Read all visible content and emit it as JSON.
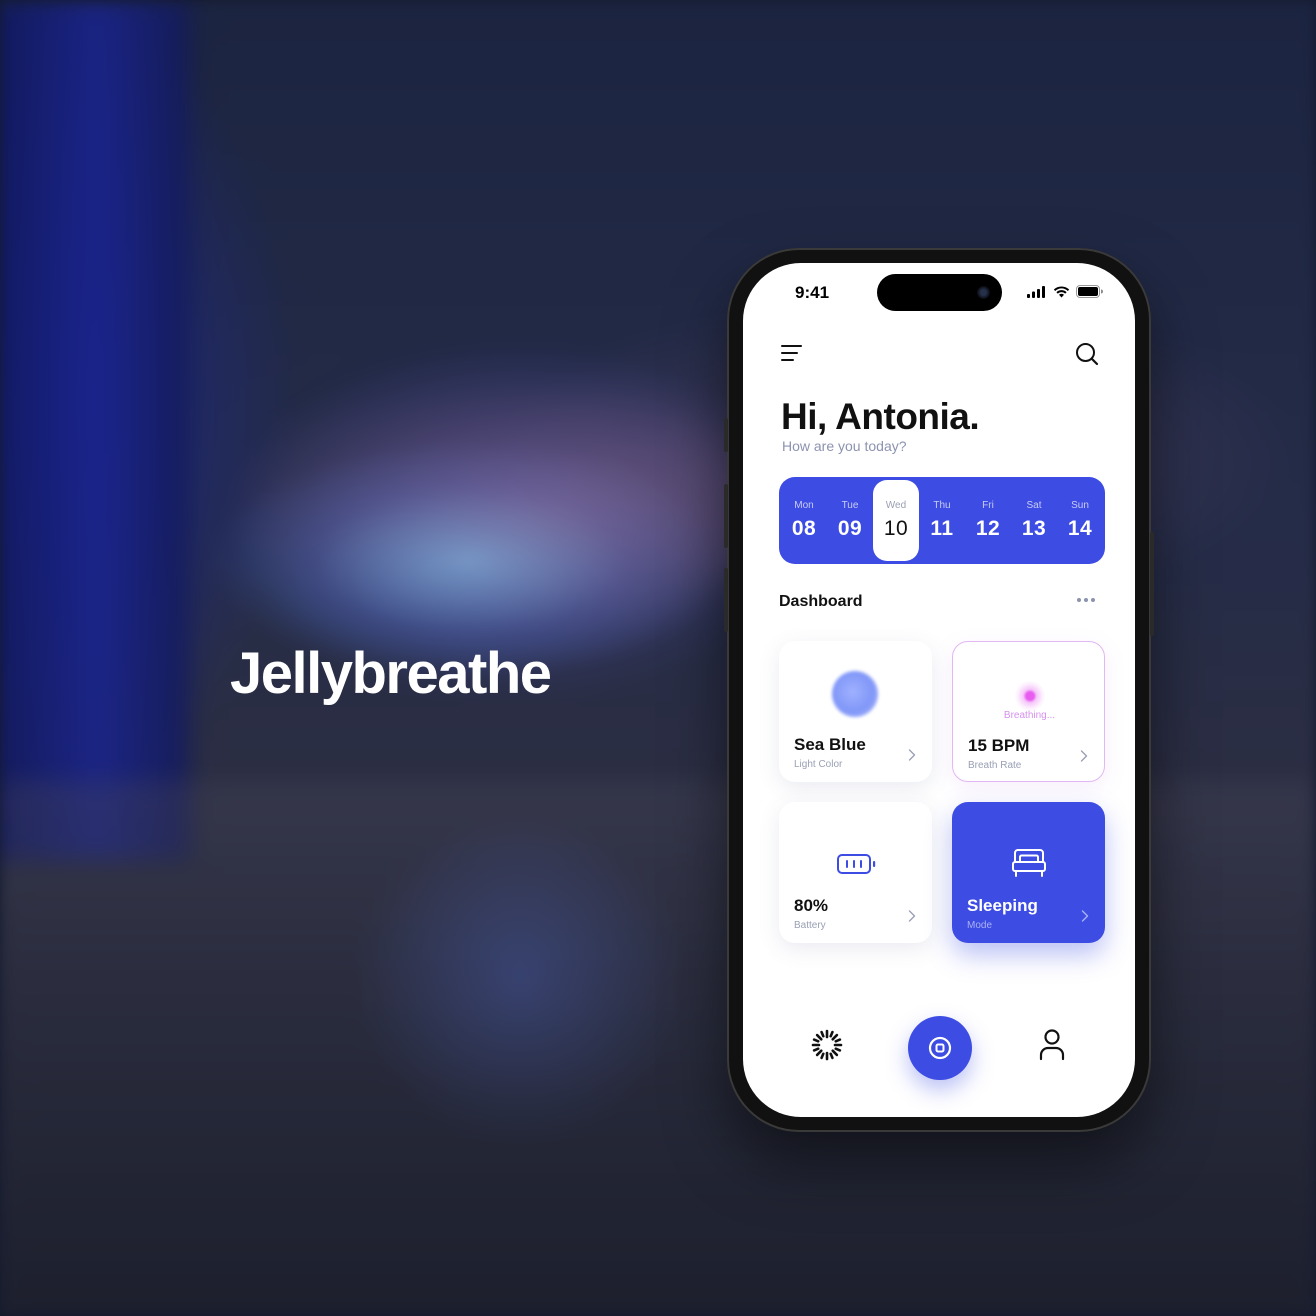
{
  "brand": {
    "name": "Jellybreathe"
  },
  "status_bar": {
    "time": "9:41"
  },
  "header": {
    "greeting": "Hi, Antonia.",
    "subtitle": "How are you today?"
  },
  "week": {
    "days": [
      {
        "name": "Mon",
        "num": "08"
      },
      {
        "name": "Tue",
        "num": "09"
      },
      {
        "name": "Wed",
        "num": "10"
      },
      {
        "name": "Thu",
        "num": "11"
      },
      {
        "name": "Fri",
        "num": "12"
      },
      {
        "name": "Sat",
        "num": "13"
      },
      {
        "name": "Sun",
        "num": "14"
      }
    ],
    "selected": "Wed"
  },
  "dashboard": {
    "title": "Dashboard",
    "cards": {
      "light": {
        "value": "Sea Blue",
        "label": "Light Color"
      },
      "breath": {
        "status": "Breathing...",
        "value": "15 BPM",
        "label": "Breath Rate"
      },
      "battery": {
        "value": "80%",
        "label": "Battery",
        "level": 0.8
      },
      "sleep": {
        "value": "Sleeping",
        "label": "Mode"
      }
    }
  },
  "colors": {
    "accent": "#3d4ce3",
    "breath_accent": "#e85cf0",
    "light_orb": "#8197f8"
  },
  "icons": {
    "menu": "menu-icon",
    "search": "search-icon",
    "more": "more-horizontal-icon",
    "chevron": "chevron-right-icon",
    "battery": "battery-icon",
    "bed": "bed-icon",
    "nav_left": "loading-spinner-icon",
    "nav_center": "stop-button-icon",
    "nav_right": "user-icon"
  }
}
